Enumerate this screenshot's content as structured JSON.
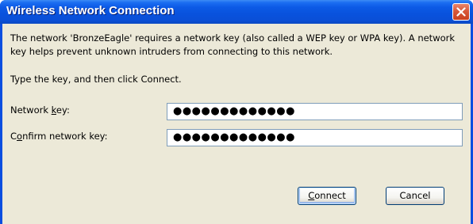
{
  "window": {
    "title": "Wireless Network Connection",
    "close_icon": "close-icon"
  },
  "body": {
    "description": "The network 'BronzeEagle' requires a network key (also called a WEP key or WPA key). A network key helps prevent unknown intruders from connecting to this network.",
    "instruction": "Type the key, and then click Connect."
  },
  "form": {
    "network_key": {
      "label_pre": "Network ",
      "label_mnemonic": "k",
      "label_post": "ey:",
      "value": "●●●●●●●●●●●●●"
    },
    "confirm_key": {
      "label_pre": "C",
      "label_mnemonic": "o",
      "label_post": "nfirm network key:",
      "value": "●●●●●●●●●●●●●"
    }
  },
  "buttons": {
    "connect_mnemonic": "C",
    "connect_rest": "onnect",
    "cancel": "Cancel"
  },
  "colors": {
    "titlebar": "#0a4fd7",
    "client": "#ece9d8",
    "close_button": "#d8583a",
    "field_border": "#7f9db9"
  }
}
